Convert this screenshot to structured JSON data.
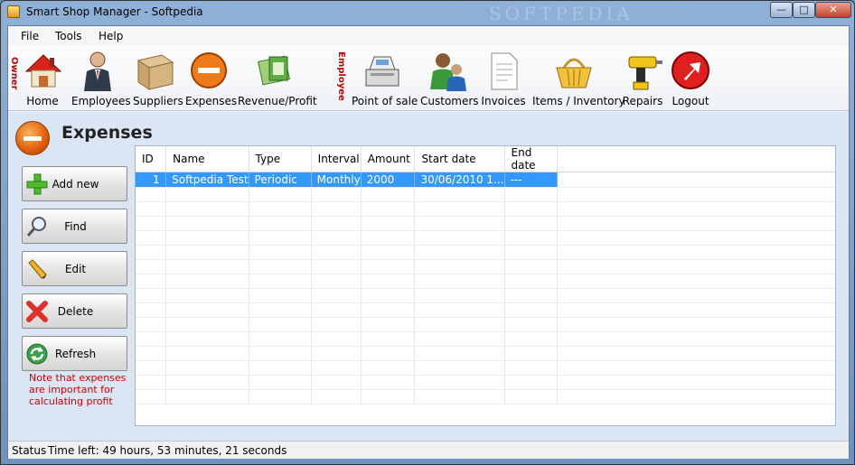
{
  "window": {
    "title": "Smart Shop Manager - Softpedia",
    "watermark": "SOFTPEDIA",
    "min": "—",
    "max": "□",
    "close": "✕"
  },
  "menu": [
    {
      "label": "File"
    },
    {
      "label": "Tools"
    },
    {
      "label": "Help"
    }
  ],
  "toolbar": {
    "owner_label": "Owner",
    "employee_label": "Employee",
    "owner_items": [
      {
        "label": "Home",
        "icon": "home-icon"
      },
      {
        "label": "Employees",
        "icon": "employee-person-icon"
      },
      {
        "label": "Suppliers",
        "icon": "supplier-box-icon"
      },
      {
        "label": "Expenses",
        "icon": "expenses-minus-icon"
      },
      {
        "label": "Revenue/Profit",
        "icon": "revenue-money-icon"
      }
    ],
    "employee_items": [
      {
        "label": "Point of sale",
        "icon": "cash-register-icon"
      },
      {
        "label": "Customers",
        "icon": "customers-people-icon"
      },
      {
        "label": "Invoices",
        "icon": "invoice-document-icon"
      },
      {
        "label": "Items / Inventory",
        "icon": "shopping-basket-icon"
      },
      {
        "label": "Repairs",
        "icon": "drill-icon"
      },
      {
        "label": "Logout",
        "icon": "logout-arrow-icon"
      }
    ]
  },
  "page": {
    "title": "Expenses"
  },
  "actions": {
    "add": "Add new",
    "find": "Find",
    "edit": "Edit",
    "delete": "Delete",
    "refresh": "Refresh",
    "note": "Note that expenses are important for calculating profit"
  },
  "grid": {
    "columns": [
      "ID",
      "Name",
      "Type",
      "Interval",
      "Amount",
      "Start date",
      "End date"
    ],
    "rows": [
      [
        "1",
        "Softpedia Test",
        "Periodic",
        "Monthly",
        "2000",
        "30/06/2010 1...",
        "---"
      ]
    ]
  },
  "status": {
    "label": "Status",
    "text": "Time left: 49 hours, 53 minutes, 21 seconds"
  },
  "colors": {
    "selection": "#3399ff",
    "note": "#d00000",
    "content_bg": "#dae6f3"
  }
}
